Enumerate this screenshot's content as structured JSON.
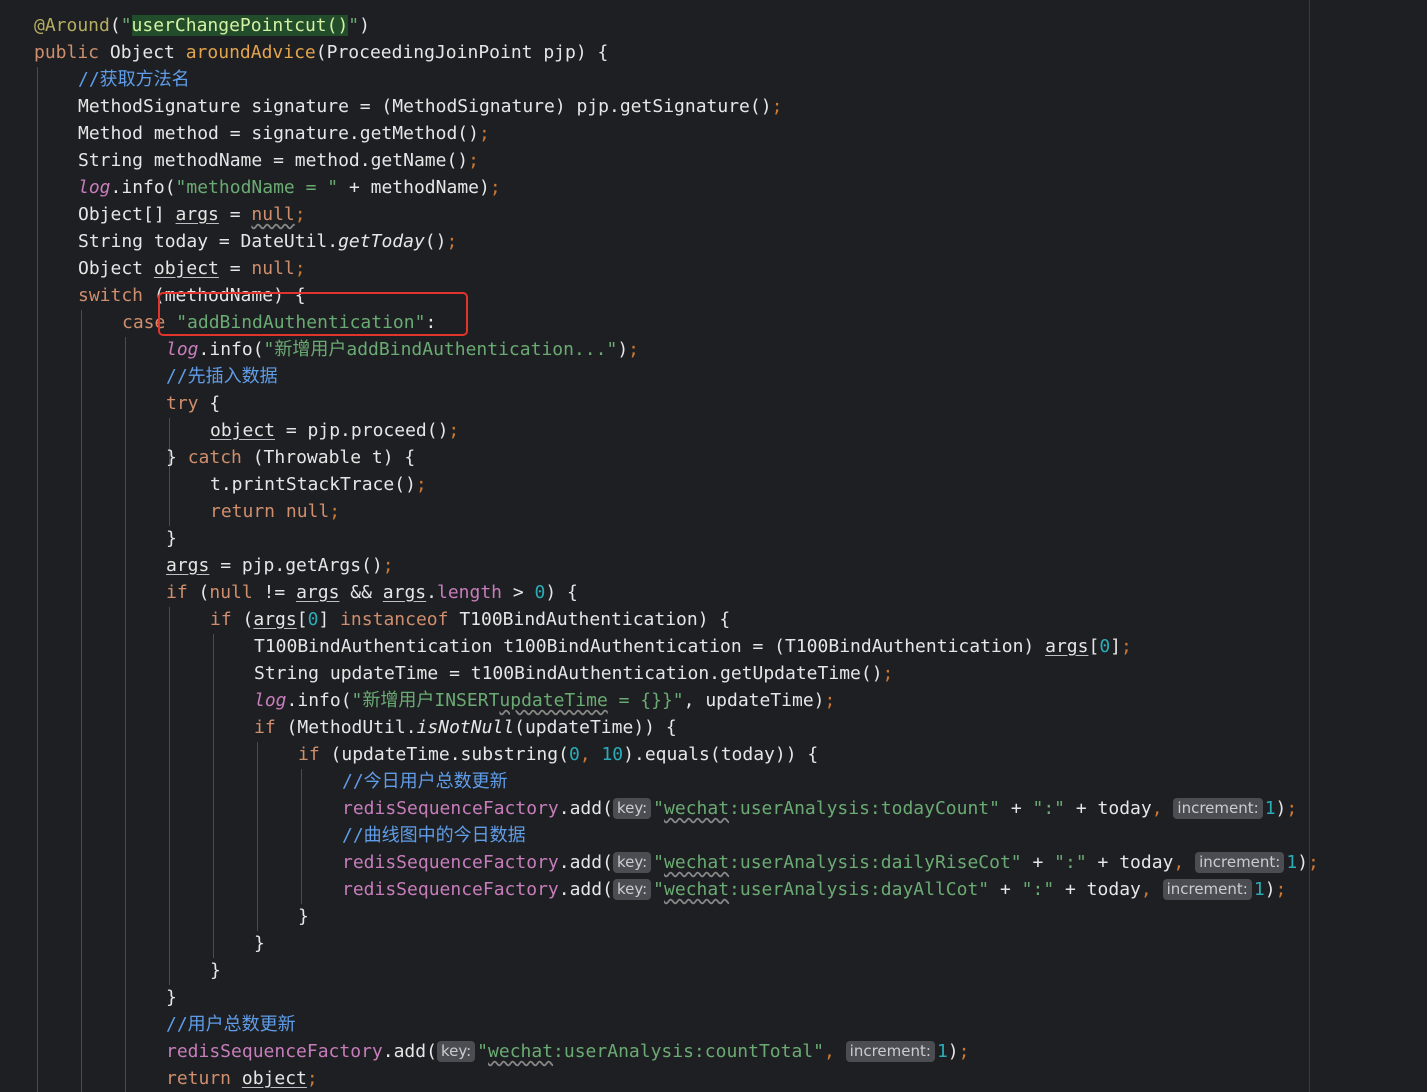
{
  "editor": {
    "lines": [
      {
        "indent": 34,
        "tokens": [
          {
            "t": "@Around",
            "c": "ann"
          },
          {
            "t": "(",
            "c": "def"
          },
          {
            "t": "\"",
            "c": "str"
          },
          {
            "t": "userChangePointcut()",
            "c": "strhl"
          },
          {
            "t": "\"",
            "c": "str"
          },
          {
            "t": ")",
            "c": "def"
          }
        ]
      },
      {
        "indent": 34,
        "tokens": [
          {
            "t": "public ",
            "c": "kw"
          },
          {
            "t": "Object ",
            "c": "def"
          },
          {
            "t": "aroundAdvice",
            "c": "fn"
          },
          {
            "t": "(ProceedingJoinPoint pjp) {",
            "c": "def"
          }
        ]
      },
      {
        "indent": 78,
        "tokens": [
          {
            "t": "//获取方法名",
            "c": "cmt"
          }
        ]
      },
      {
        "indent": 78,
        "tokens": [
          {
            "t": "MethodSignature signature = (MethodSignature) pjp.getSignature()",
            "c": "def"
          },
          {
            "t": ";",
            "c": "sem"
          }
        ]
      },
      {
        "indent": 78,
        "tokens": [
          {
            "t": "Method method = signature.getMethod()",
            "c": "def"
          },
          {
            "t": ";",
            "c": "sem"
          }
        ]
      },
      {
        "indent": 78,
        "tokens": [
          {
            "t": "String methodName = method.getName()",
            "c": "def"
          },
          {
            "t": ";",
            "c": "sem"
          }
        ]
      },
      {
        "indent": 78,
        "tokens": [
          {
            "t": "log",
            "c": "fld ital"
          },
          {
            "t": ".info(",
            "c": "def"
          },
          {
            "t": "\"methodName = \"",
            "c": "str"
          },
          {
            "t": " + methodName)",
            "c": "def"
          },
          {
            "t": ";",
            "c": "sem"
          }
        ]
      },
      {
        "indent": 78,
        "tokens": [
          {
            "t": "Object[] ",
            "c": "def"
          },
          {
            "t": "args",
            "c": "def uline"
          },
          {
            "t": " = ",
            "c": "def"
          },
          {
            "t": "null",
            "c": "kw wavy"
          },
          {
            "t": ";",
            "c": "sem"
          }
        ]
      },
      {
        "indent": 78,
        "tokens": [
          {
            "t": "String today = DateUtil.",
            "c": "def"
          },
          {
            "t": "getToday",
            "c": "def static"
          },
          {
            "t": "()",
            "c": "def"
          },
          {
            "t": ";",
            "c": "sem"
          }
        ]
      },
      {
        "indent": 78,
        "tokens": [
          {
            "t": "Object ",
            "c": "def"
          },
          {
            "t": "object",
            "c": "def uline"
          },
          {
            "t": " = ",
            "c": "def"
          },
          {
            "t": "null",
            "c": "kw"
          },
          {
            "t": ";",
            "c": "sem"
          }
        ]
      },
      {
        "indent": 78,
        "tokens": [
          {
            "t": "switch ",
            "c": "kw"
          },
          {
            "t": "(methodName) {",
            "c": "def"
          }
        ]
      },
      {
        "indent": 122,
        "tokens": [
          {
            "t": "case ",
            "c": "kw"
          },
          {
            "t": "\"addBindAuthentication\"",
            "c": "str"
          },
          {
            "t": ":",
            "c": "def"
          }
        ]
      },
      {
        "indent": 166,
        "tokens": [
          {
            "t": "log",
            "c": "fld ital"
          },
          {
            "t": ".info(",
            "c": "def"
          },
          {
            "t": "\"新增用户addBindAuthentication...\"",
            "c": "str"
          },
          {
            "t": ")",
            "c": "def"
          },
          {
            "t": ";",
            "c": "sem"
          }
        ]
      },
      {
        "indent": 166,
        "tokens": [
          {
            "t": "//先插入数据",
            "c": "cmt"
          }
        ]
      },
      {
        "indent": 166,
        "tokens": [
          {
            "t": "try ",
            "c": "kw"
          },
          {
            "t": "{",
            "c": "def"
          }
        ]
      },
      {
        "indent": 210,
        "tokens": [
          {
            "t": "object",
            "c": "def uline"
          },
          {
            "t": " = pjp.proceed()",
            "c": "def"
          },
          {
            "t": ";",
            "c": "sem"
          }
        ]
      },
      {
        "indent": 166,
        "tokens": [
          {
            "t": "} ",
            "c": "def"
          },
          {
            "t": "catch ",
            "c": "kw"
          },
          {
            "t": "(Throwable t) {",
            "c": "def"
          }
        ]
      },
      {
        "indent": 210,
        "tokens": [
          {
            "t": "t.printStackTrace()",
            "c": "def"
          },
          {
            "t": ";",
            "c": "sem"
          }
        ]
      },
      {
        "indent": 210,
        "tokens": [
          {
            "t": "return null",
            "c": "kw"
          },
          {
            "t": ";",
            "c": "sem"
          }
        ]
      },
      {
        "indent": 166,
        "tokens": [
          {
            "t": "}",
            "c": "def"
          }
        ]
      },
      {
        "indent": 166,
        "tokens": [
          {
            "t": "args",
            "c": "def uline"
          },
          {
            "t": " = pjp.getArgs()",
            "c": "def"
          },
          {
            "t": ";",
            "c": "sem"
          }
        ]
      },
      {
        "indent": 166,
        "tokens": [
          {
            "t": "if ",
            "c": "kw"
          },
          {
            "t": "(",
            "c": "def"
          },
          {
            "t": "null ",
            "c": "kw"
          },
          {
            "t": "!= ",
            "c": "def"
          },
          {
            "t": "args",
            "c": "def uline"
          },
          {
            "t": " && ",
            "c": "def"
          },
          {
            "t": "args",
            "c": "def uline"
          },
          {
            "t": ".",
            "c": "def"
          },
          {
            "t": "length",
            "c": "fld"
          },
          {
            "t": " > ",
            "c": "def"
          },
          {
            "t": "0",
            "c": "num"
          },
          {
            "t": ") {",
            "c": "def"
          }
        ]
      },
      {
        "indent": 210,
        "tokens": [
          {
            "t": "if ",
            "c": "kw"
          },
          {
            "t": "(",
            "c": "def"
          },
          {
            "t": "args",
            "c": "def uline"
          },
          {
            "t": "[",
            "c": "def"
          },
          {
            "t": "0",
            "c": "num"
          },
          {
            "t": "] ",
            "c": "def"
          },
          {
            "t": "instanceof ",
            "c": "kw"
          },
          {
            "t": "T100BindAuthentication) {",
            "c": "def"
          }
        ]
      },
      {
        "indent": 254,
        "tokens": [
          {
            "t": "T100BindAuthentication t100BindAuthentication = (T100BindAuthentication) ",
            "c": "def"
          },
          {
            "t": "args",
            "c": "def uline"
          },
          {
            "t": "[",
            "c": "def"
          },
          {
            "t": "0",
            "c": "num"
          },
          {
            "t": "]",
            "c": "def"
          },
          {
            "t": ";",
            "c": "sem"
          }
        ]
      },
      {
        "indent": 254,
        "tokens": [
          {
            "t": "String updateTime = t100BindAuthentication.getUpdateTime()",
            "c": "def"
          },
          {
            "t": ";",
            "c": "sem"
          }
        ]
      },
      {
        "indent": 254,
        "tokens": [
          {
            "t": "log",
            "c": "fld ital"
          },
          {
            "t": ".info(",
            "c": "def"
          },
          {
            "t": "\"新增用户INSERT",
            "c": "str"
          },
          {
            "t": "updateTime",
            "c": "str wavy"
          },
          {
            "t": " = {}}\"",
            "c": "str"
          },
          {
            "t": ", updateTime)",
            "c": "def"
          },
          {
            "t": ";",
            "c": "sem"
          }
        ]
      },
      {
        "indent": 254,
        "tokens": [
          {
            "t": "if ",
            "c": "kw"
          },
          {
            "t": "(MethodUtil.",
            "c": "def"
          },
          {
            "t": "isNotNull",
            "c": "def static"
          },
          {
            "t": "(updateTime)) {",
            "c": "def"
          }
        ]
      },
      {
        "indent": 298,
        "tokens": [
          {
            "t": "if ",
            "c": "kw"
          },
          {
            "t": "(updateTime.substring(",
            "c": "def"
          },
          {
            "t": "0",
            "c": "num"
          },
          {
            "t": ", ",
            "c": "sem"
          },
          {
            "t": "10",
            "c": "num"
          },
          {
            "t": ").equals(today)) {",
            "c": "def"
          }
        ]
      },
      {
        "indent": 342,
        "tokens": [
          {
            "t": "//今日用户总数更新",
            "c": "cmt"
          }
        ]
      },
      {
        "indent": 342,
        "tokens": [
          {
            "t": "redisSequenceFactory",
            "c": "fld"
          },
          {
            "t": ".add(",
            "c": "def"
          },
          {
            "t": "key:",
            "c": "hint"
          },
          {
            "t": "\"",
            "c": "str"
          },
          {
            "t": "wechat",
            "c": "str wavy"
          },
          {
            "t": ":userAnalysis:todayCount\"",
            "c": "str"
          },
          {
            "t": " + ",
            "c": "def"
          },
          {
            "t": "\":\"",
            "c": "str"
          },
          {
            "t": " + today",
            "c": "def"
          },
          {
            "t": ", ",
            "c": "sem"
          },
          {
            "t": "increment:",
            "c": "hint"
          },
          {
            "t": "1",
            "c": "num"
          },
          {
            "t": ")",
            "c": "def"
          },
          {
            "t": ";",
            "c": "sem"
          }
        ]
      },
      {
        "indent": 342,
        "tokens": [
          {
            "t": "//曲线图中的今日数据",
            "c": "cmt"
          }
        ]
      },
      {
        "indent": 342,
        "tokens": [
          {
            "t": "redisSequenceFactory",
            "c": "fld"
          },
          {
            "t": ".add(",
            "c": "def"
          },
          {
            "t": "key:",
            "c": "hint"
          },
          {
            "t": "\"",
            "c": "str"
          },
          {
            "t": "wechat",
            "c": "str wavy"
          },
          {
            "t": ":userAnalysis:dailyRiseCot\"",
            "c": "str"
          },
          {
            "t": " + ",
            "c": "def"
          },
          {
            "t": "\":\"",
            "c": "str"
          },
          {
            "t": " + today",
            "c": "def"
          },
          {
            "t": ", ",
            "c": "sem"
          },
          {
            "t": "increment:",
            "c": "hint"
          },
          {
            "t": "1",
            "c": "num"
          },
          {
            "t": ")",
            "c": "def"
          },
          {
            "t": ";",
            "c": "sem"
          }
        ]
      },
      {
        "indent": 342,
        "tokens": [
          {
            "t": "redisSequenceFactory",
            "c": "fld"
          },
          {
            "t": ".add(",
            "c": "def"
          },
          {
            "t": "key:",
            "c": "hint"
          },
          {
            "t": "\"",
            "c": "str"
          },
          {
            "t": "wechat",
            "c": "str wavy"
          },
          {
            "t": ":userAnalysis:dayAllCot\"",
            "c": "str"
          },
          {
            "t": " + ",
            "c": "def"
          },
          {
            "t": "\":\"",
            "c": "str"
          },
          {
            "t": " + today",
            "c": "def"
          },
          {
            "t": ", ",
            "c": "sem"
          },
          {
            "t": "increment:",
            "c": "hint"
          },
          {
            "t": "1",
            "c": "num"
          },
          {
            "t": ")",
            "c": "def"
          },
          {
            "t": ";",
            "c": "sem"
          }
        ]
      },
      {
        "indent": 298,
        "tokens": [
          {
            "t": "}",
            "c": "def"
          }
        ]
      },
      {
        "indent": 254,
        "tokens": [
          {
            "t": "}",
            "c": "def"
          }
        ]
      },
      {
        "indent": 210,
        "tokens": [
          {
            "t": "}",
            "c": "def"
          }
        ]
      },
      {
        "indent": 166,
        "tokens": [
          {
            "t": "}",
            "c": "def"
          }
        ]
      },
      {
        "indent": 166,
        "tokens": [
          {
            "t": "//用户总数更新",
            "c": "cmt"
          }
        ]
      },
      {
        "indent": 166,
        "tokens": [
          {
            "t": "redisSequenceFactory",
            "c": "fld"
          },
          {
            "t": ".add(",
            "c": "def"
          },
          {
            "t": "key:",
            "c": "hint"
          },
          {
            "t": "\"",
            "c": "str"
          },
          {
            "t": "wechat",
            "c": "str wavy"
          },
          {
            "t": ":userAnalysis:countTotal\"",
            "c": "str"
          },
          {
            "t": ", ",
            "c": "sem"
          },
          {
            "t": "increment:",
            "c": "hint"
          },
          {
            "t": "1",
            "c": "num"
          },
          {
            "t": ")",
            "c": "def"
          },
          {
            "t": ";",
            "c": "sem"
          }
        ]
      },
      {
        "indent": 166,
        "tokens": [
          {
            "t": "return ",
            "c": "kw"
          },
          {
            "t": "object",
            "c": "def uline"
          },
          {
            "t": ";",
            "c": "sem"
          }
        ]
      }
    ]
  },
  "colors": {
    "background": "#1e1f22",
    "highlight_box": "#e0342c"
  }
}
